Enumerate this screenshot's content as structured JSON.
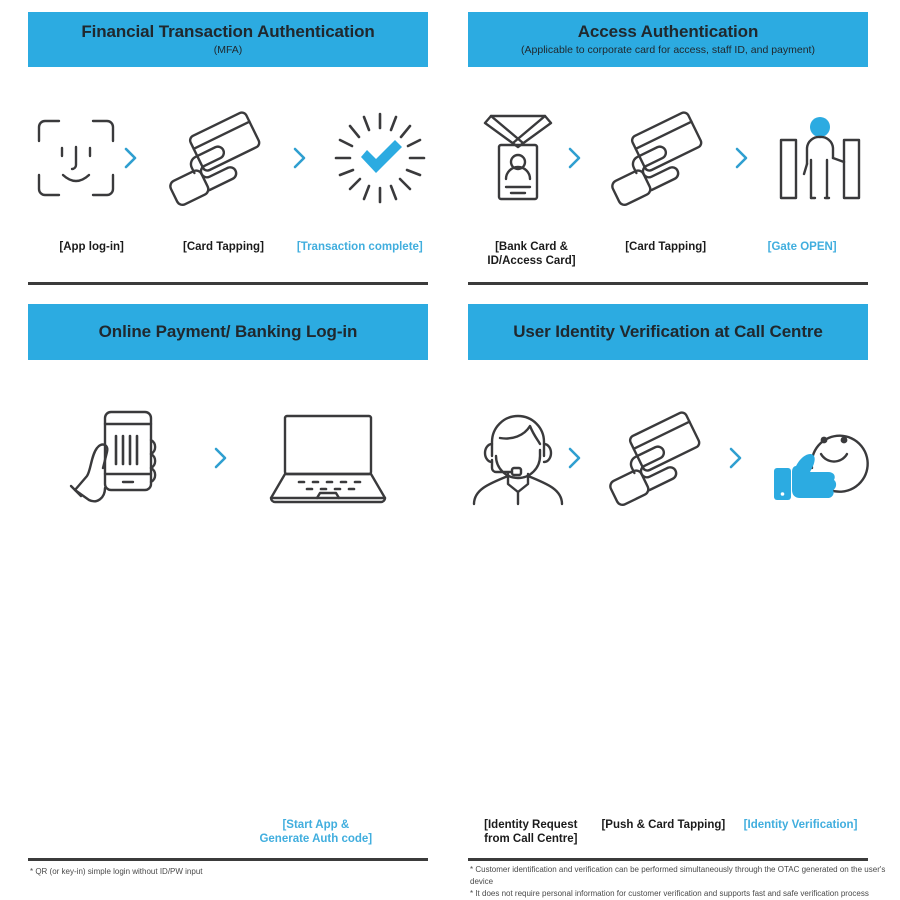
{
  "panels": [
    {
      "id": "financial-transaction-authentication",
      "title": "Financial Transaction Authentication",
      "subtitle": "(MFA)",
      "steps": [
        {
          "icon": "face-id-icon",
          "label": "[App log-in]",
          "accent": false
        },
        {
          "icon": "card-tapping-icon",
          "label": "[Card Tapping]",
          "accent": false
        },
        {
          "icon": "check-burst-icon",
          "label": "[Transaction complete]",
          "accent": true
        }
      ],
      "footnotes": []
    },
    {
      "id": "access-authentication",
      "title": "Access Authentication",
      "subtitle": "(Applicable to corporate card for access, staff ID, and payment)",
      "steps": [
        {
          "icon": "id-badge-icon",
          "label": "[Bank Card &\nID/Access Card]",
          "accent": false
        },
        {
          "icon": "card-tapping-icon",
          "label": "[Card Tapping]",
          "accent": false
        },
        {
          "icon": "gate-open-icon",
          "label": "[Gate OPEN]",
          "accent": true
        }
      ],
      "footnotes": []
    },
    {
      "id": "online-payment-banking-login",
      "title": "Online Payment/ Banking Log-in",
      "subtitle": "",
      "steps": [
        {
          "icon": "hand-phone-barcode-icon",
          "label": "",
          "accent": false
        },
        {
          "icon": "laptop-icon",
          "label": "[Start App &\nGenerate Auth code]",
          "accent": true
        }
      ],
      "footnotes": [
        "* QR (or key-in) simple login without ID/PW input"
      ]
    },
    {
      "id": "user-identity-verification-call-centre",
      "title": "User Identity Verification at Call Centre",
      "subtitle": "",
      "steps": [
        {
          "icon": "call-centre-agent-icon",
          "label": "[Identity Request\nfrom Call Centre]",
          "accent": false
        },
        {
          "icon": "card-tapping-icon",
          "label": "[Push & Card Tapping]",
          "accent": false
        },
        {
          "icon": "thumbs-up-smiley-icon",
          "label": "[Identity Verification]",
          "accent": true
        }
      ],
      "footnotes": [
        "* Customer identification and verification can be performed simultaneously through the OTAC generated on the user's device",
        "* It does not require personal information for customer verification and supports fast and safe verification process"
      ]
    }
  ],
  "colors": {
    "banner_blue": "#2cabe1",
    "accent_text_blue": "#41aede",
    "chevron_blue": "#2f9fd0",
    "line_dark": "#3a3a3c",
    "divider": "#3b3b3b"
  },
  "icons": {
    "chevron": "chevron-right-icon"
  }
}
